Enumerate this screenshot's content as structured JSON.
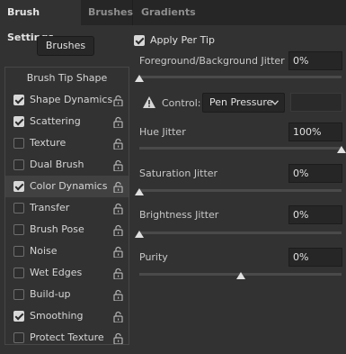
{
  "tabs": [
    {
      "label": "Brush Settings",
      "active": true
    },
    {
      "label": "Brushes",
      "active": false
    },
    {
      "label": "Gradients",
      "active": false
    }
  ],
  "brushes_button": "Brushes",
  "left_items": [
    {
      "label": "Brush Tip Shape",
      "header": true
    },
    {
      "label": "Shape Dynamics",
      "checked": true
    },
    {
      "label": "Scattering",
      "checked": true
    },
    {
      "label": "Texture",
      "checked": false
    },
    {
      "label": "Dual Brush",
      "checked": false
    },
    {
      "label": "Color Dynamics",
      "checked": true,
      "selected": true
    },
    {
      "label": "Transfer",
      "checked": false
    },
    {
      "label": "Brush Pose",
      "checked": false
    },
    {
      "label": "Noise",
      "checked": false
    },
    {
      "label": "Wet Edges",
      "checked": false
    },
    {
      "label": "Build-up",
      "checked": false
    },
    {
      "label": "Smoothing",
      "checked": true
    },
    {
      "label": "Protect Texture",
      "checked": false
    }
  ],
  "apply_per_tip": {
    "label": "Apply Per Tip",
    "checked": true
  },
  "fg_bg_jitter": {
    "label": "Foreground/Background Jitter",
    "value": "0%",
    "level": 0
  },
  "control": {
    "label": "Control:",
    "value": "Pen Pressure",
    "warning_icon": "warning-icon"
  },
  "hue_jitter": {
    "label": "Hue Jitter",
    "value": "100%",
    "level": 100
  },
  "saturation_jitter": {
    "label": "Saturation Jitter",
    "value": "0%",
    "level": 0
  },
  "brightness_jitter": {
    "label": "Brightness Jitter",
    "value": "0%",
    "level": 0
  },
  "purity": {
    "label": "Purity",
    "value": "0%",
    "level": 50
  },
  "colors": {
    "panel": "#323232",
    "tabbar": "#262626",
    "text": "#d6d6d6"
  }
}
